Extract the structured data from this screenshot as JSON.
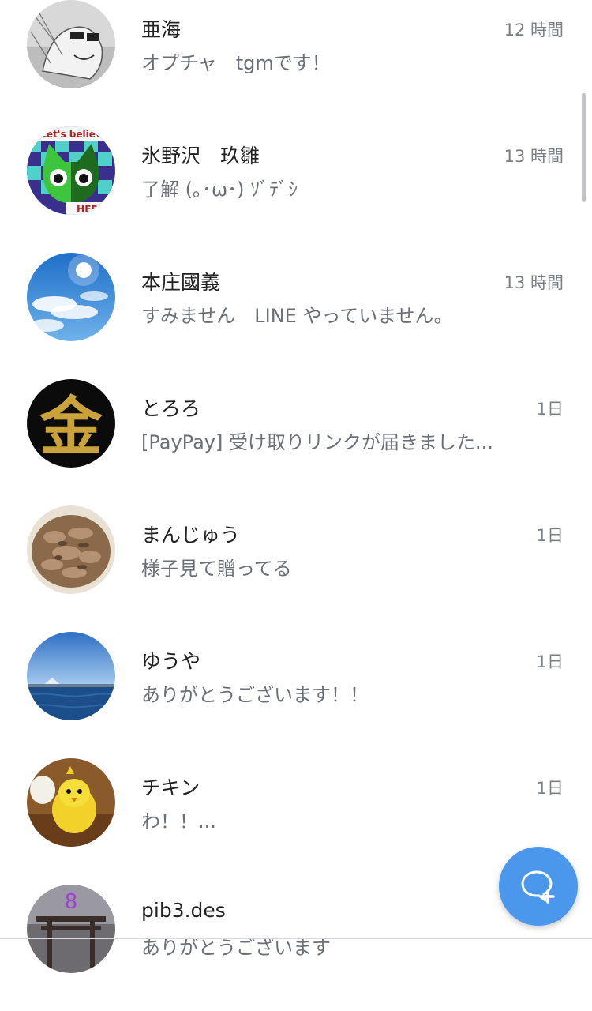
{
  "chats": [
    {
      "name": "亜海",
      "preview": "オプチャ　tgmです！",
      "time": "12 時間",
      "avatar": "manga-sketch-avatar"
    },
    {
      "name": "氷野沢　玖雛",
      "preview": "了解 (｡･ω･) ｿﾞﾃﾞｼ",
      "time": "13 時間",
      "avatar": "green-cat-avatar",
      "avatar_text_top": "Let's believ",
      "avatar_text_bottom": "HERO"
    },
    {
      "name": "本庄國義",
      "preview": "すみません　LINE やっていません。",
      "time": "13 時間",
      "avatar": "sky-sun-avatar"
    },
    {
      "name": "とろろ",
      "preview": "[PayPay] 受け取りリンクが届きました...",
      "time": "1日",
      "avatar": "gold-kanji-avatar",
      "avatar_text": "金"
    },
    {
      "name": "まんじゅう",
      "preview": "様子見て贈ってる",
      "time": "1日",
      "avatar": "food-bowl-avatar"
    },
    {
      "name": "ゆうや",
      "preview": "ありがとうございます！！",
      "time": "1日",
      "avatar": "ocean-mountain-avatar"
    },
    {
      "name": "チキン",
      "preview": "わ！！...",
      "time": "1日",
      "avatar": "yellow-chick-avatar"
    },
    {
      "name": "pib3.des",
      "preview": "ありがとうございます",
      "time": "1日",
      "avatar": "torii-gate-avatar",
      "avatar_text": "8"
    }
  ],
  "colors": {
    "name": "#222222",
    "preview": "#6b6f76",
    "time": "#7a7e85",
    "fab": "#4a97ec"
  },
  "fab": {
    "icon": "new-chat-plus-icon"
  }
}
